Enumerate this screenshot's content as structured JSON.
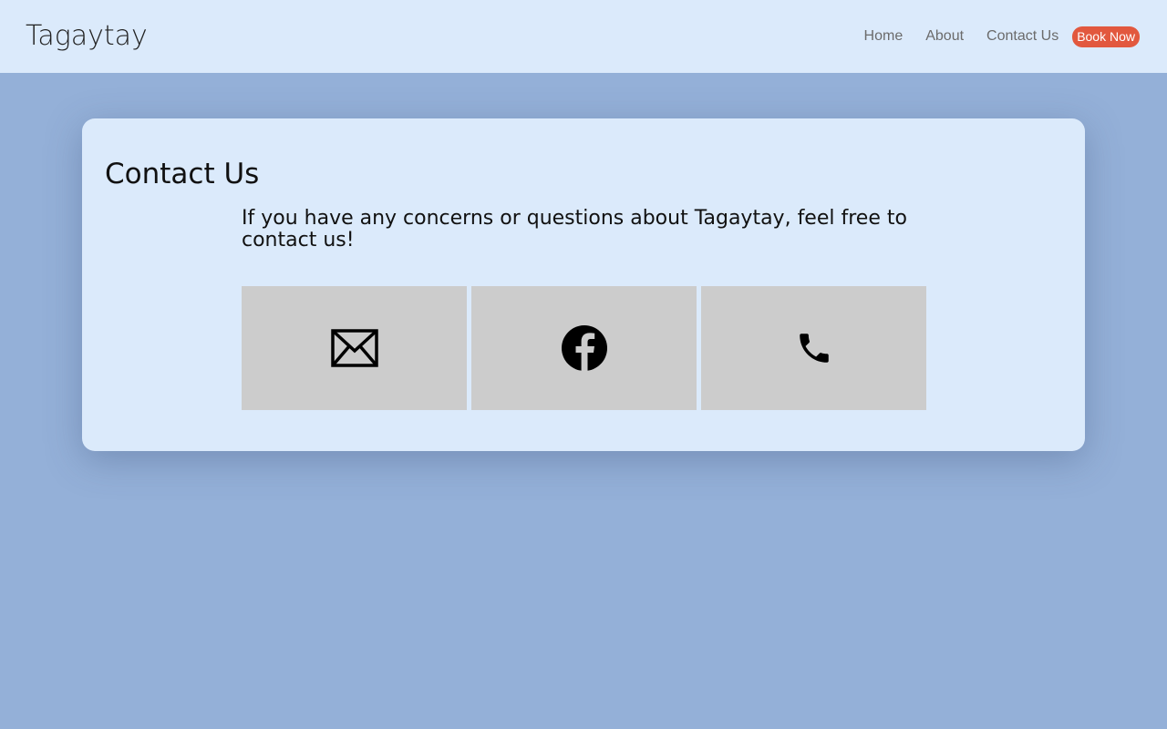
{
  "brand": {
    "logo_text": "Tagaytay"
  },
  "nav": {
    "links": [
      "Home",
      "About",
      "Contact Us"
    ],
    "cta_label": "Book Now"
  },
  "contact": {
    "title": "Contact Us",
    "description": "If you have any concerns or questions about Tagaytay, feel free to contact us!",
    "tiles": [
      {
        "icon": "envelope-icon"
      },
      {
        "icon": "facebook-icon"
      },
      {
        "icon": "phone-icon"
      }
    ]
  },
  "colors": {
    "page_background": "#94b0d8",
    "panel_background": "#dbeafb",
    "tile_background": "#cccccc",
    "accent": "#e2583e"
  }
}
